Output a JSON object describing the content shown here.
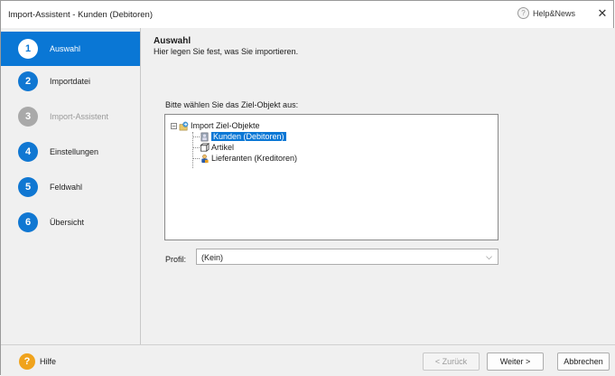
{
  "window": {
    "title": "Import-Assistent - Kunden (Debitoren)",
    "help_news_label": "Help&News",
    "help_news_icon": "?",
    "close_label": "✕"
  },
  "sidebar": {
    "items": [
      {
        "number": "1",
        "label": "Auswahl",
        "state": "active"
      },
      {
        "number": "2",
        "label": "Importdatei",
        "state": "normal"
      },
      {
        "number": "3",
        "label": "Import-Assistent",
        "state": "disabled"
      },
      {
        "number": "4",
        "label": "Einstellungen",
        "state": "normal"
      },
      {
        "number": "5",
        "label": "Feldwahl",
        "state": "normal"
      },
      {
        "number": "6",
        "label": "Übersicht",
        "state": "normal"
      }
    ]
  },
  "header": {
    "title": "Auswahl",
    "subtitle": "Hier legen Sie fest, was Sie importieren."
  },
  "main": {
    "prompt": "Bitte wählen Sie das Ziel-Objekt aus:",
    "tree": {
      "root_label": "Import Ziel-Objekte",
      "root_expander": "⊟",
      "children": [
        {
          "label": "Kunden (Debitoren)",
          "selected": true,
          "icon": "customer-icon"
        },
        {
          "label": "Artikel",
          "selected": false,
          "icon": "article-icon"
        },
        {
          "label": "Lieferanten (Kreditoren)",
          "selected": false,
          "icon": "supplier-icon"
        }
      ]
    },
    "profile_label": "Profil:",
    "profile_value": "(Kein)"
  },
  "footer": {
    "help_label": "Hilfe",
    "help_icon_text": "?",
    "back_label": "< Zurück",
    "next_label": "Weiter >",
    "cancel_label": "Abbrechen"
  },
  "colors": {
    "accent": "#0a77d5",
    "step_disabled": "#a9a9a9",
    "help_orange": "#f0a31c"
  }
}
